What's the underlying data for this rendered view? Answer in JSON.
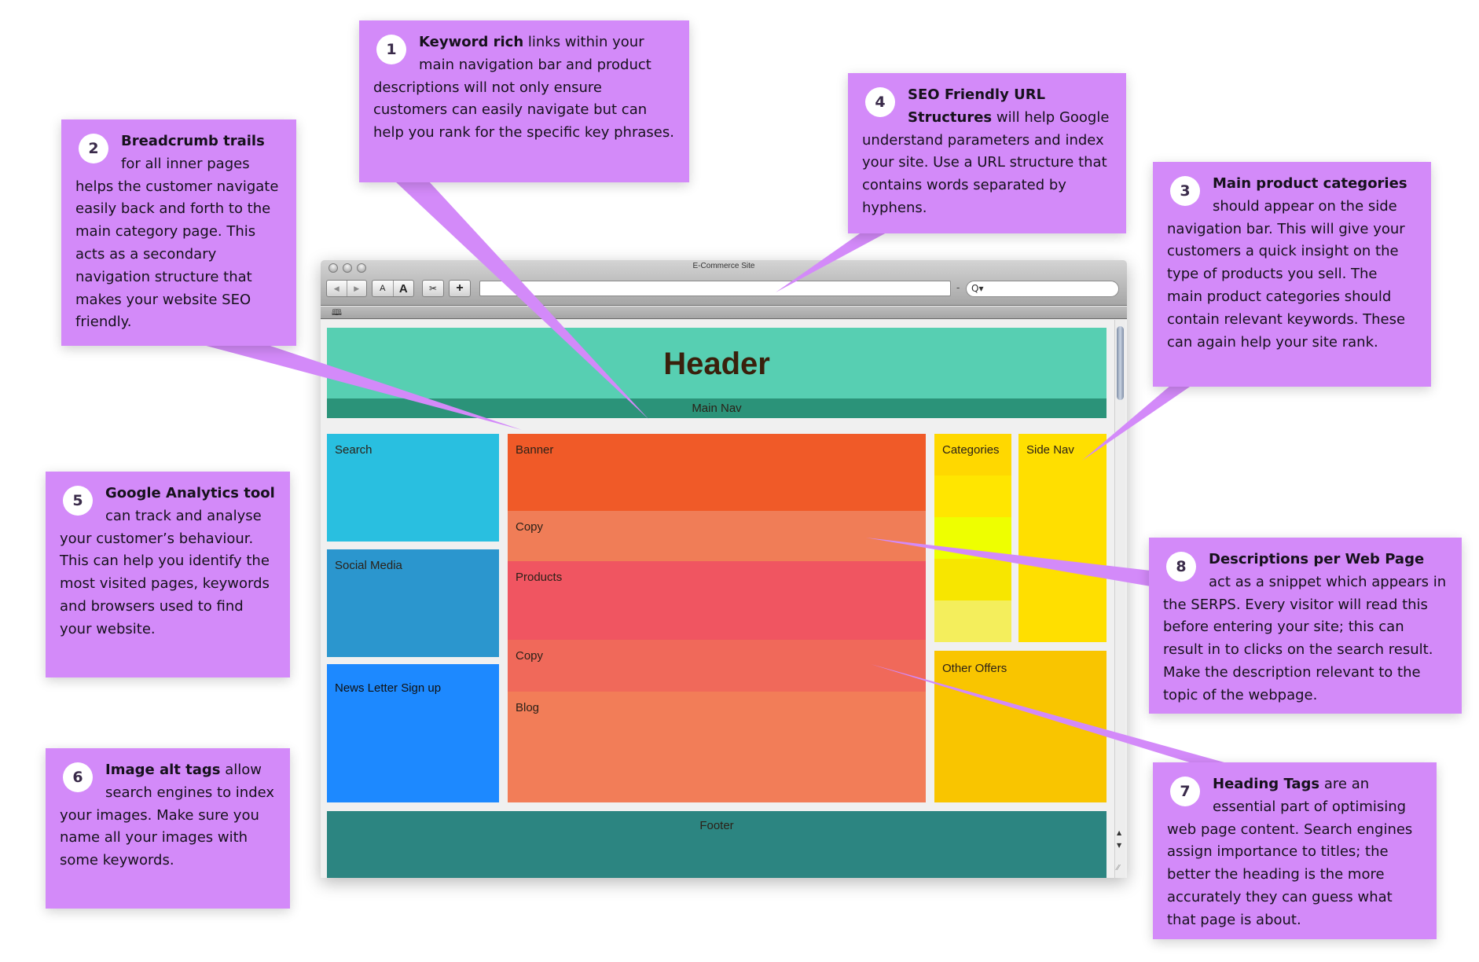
{
  "browser": {
    "title": "E-Commerce Site",
    "toolbar": {
      "back_icon": "◀",
      "forward_icon": "▶",
      "text_smaller_label": "A",
      "text_larger_label": "A",
      "clip_icon": "✂",
      "add_bookmark_label": "+",
      "address_value": "",
      "address_separator": "-",
      "search_icon": "Q▾",
      "search_value": ""
    },
    "bookmarks_icon": "🕮",
    "scroll_up_icon": "▲",
    "scroll_down_icon": "▼",
    "resize_icon": "⁄⁄"
  },
  "wireframe": {
    "header": "Header",
    "main_nav": "Main Nav",
    "search": "Search",
    "social_media": "Social Media",
    "newsletter": "News Letter Sign up",
    "banner": "Banner",
    "copy_1": "Copy",
    "products": "Products",
    "copy_2": "Copy",
    "blog": "Blog",
    "categories": "Categories",
    "side_nav": "Side Nav",
    "other_offers": "Other Offers",
    "footer": "Footer",
    "colors": {
      "header": "#57cfb2",
      "main_nav": "#2b9379",
      "search": "#29bfe0",
      "social_media": "#2b96ce",
      "newsletter": "#1d89ff",
      "banner": "#f05a28",
      "copy_1": "#f07d57",
      "products": "#f05561",
      "copy_2": "#f0695a",
      "blog": "#f27d58",
      "categories": [
        "#ffd800",
        "#ffe600",
        "#eeff00",
        "#f7e600",
        "#f4ee5c"
      ],
      "side_nav": "#ffdf00",
      "other_offers": "#f9c500",
      "footer": "#2c8581"
    }
  },
  "callouts": [
    {
      "number": "1",
      "bold": "Keyword rich",
      "text": " links within your main navigation bar and product descriptions will not only ensure customers can easily navigate but can help you rank for the specific key phrases."
    },
    {
      "number": "2",
      "bold": "Breadcrumb trails",
      "text": " for all inner pages helps the customer navigate easily back and forth to the main category page. This acts as a secondary navigation structure that makes your website SEO friendly."
    },
    {
      "number": "3",
      "bold": "Main product categories",
      "text": " should appear on the side navigation bar. This will give your customers a quick insight on the type of products you sell. The main product categories should contain relevant keywords. These can again help your site rank."
    },
    {
      "number": "4",
      "bold": "SEO Friendly URL Structures",
      "text": " will help Google understand parameters and index your site. Use a URL structure that contains words separated by hyphens."
    },
    {
      "number": "5",
      "bold": "Google Analytics tool",
      "text": " can track and analyse your customer’s behaviour. This can help you identify the most visited pages, keywords and browsers used to find your website."
    },
    {
      "number": "6",
      "bold": "Image alt tags",
      "text": " allow search engines to index your images. Make sure you name all your images with some keywords."
    },
    {
      "number": "7",
      "bold": "Heading Tags",
      "text": " are an essential part of optimising web page content. Search engines assign importance to titles; the better the heading is the more accurately they can guess what that page is about."
    },
    {
      "number": "8",
      "bold": "Descriptions per Web Page",
      "text": " act as a snippet which appears in the SERPS. Every visitor will read this before entering your site; this can result in to clicks on the search result. Make the description relevant to the topic of the webpage."
    }
  ],
  "accent_color": "#d38af9"
}
